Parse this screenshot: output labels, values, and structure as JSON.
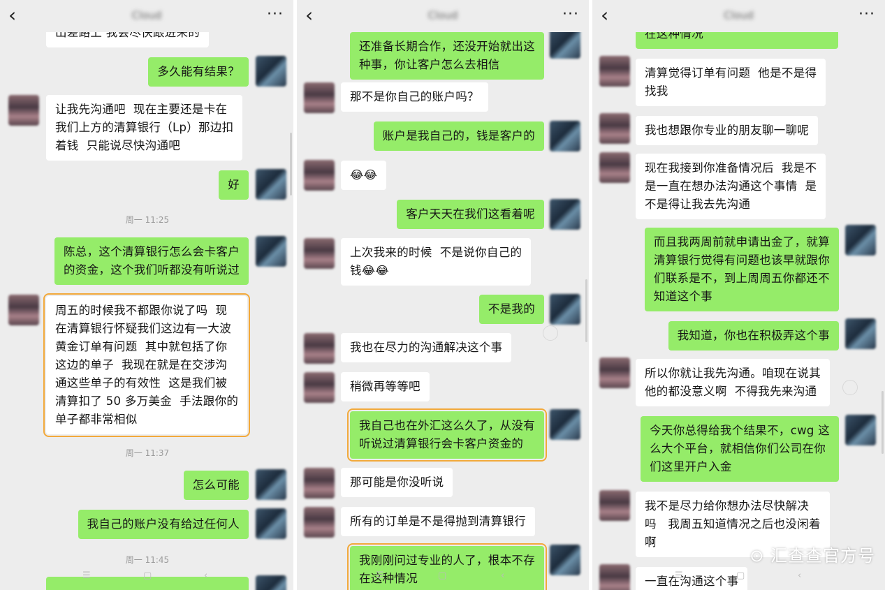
{
  "panels": [
    {
      "title": "Cloud",
      "messages": [
        {
          "side": "in",
          "text": "出差路上 我会尽快跟进来的"
        },
        {
          "side": "out",
          "text": "多久能有结果？"
        },
        {
          "side": "in",
          "text": "让我先沟通吧  现在主要还是卡在\n我们上方的清算银行（Lp）那边扣\n着钱  只能说尽快沟通吧"
        },
        {
          "side": "out",
          "text": "好"
        },
        {
          "time": "周一 11:25"
        },
        {
          "side": "out",
          "text": "陈总，这个清算银行怎么会卡客户\n的资金，这个我们听都没有听说过"
        },
        {
          "side": "in",
          "text": "周五的时候我不都跟你说了吗  现\n在清算银行怀疑我们这边有一大波\n黄金订单有问题  其中就包括了你\n这边的单子  我现在就是在交涉沟\n通这些单子的有效性  这是我们被\n清算扣了 50 多万美金  手法跟你的\n单子都非常相似"
        },
        {
          "time": "周一 11:37"
        },
        {
          "side": "out",
          "text": "怎么可能"
        },
        {
          "side": "out",
          "text": "我自己的账户没有给过任何人"
        },
        {
          "time": "周一 11:45"
        }
      ]
    },
    {
      "title": "Cloud",
      "messages": [
        {
          "side": "out",
          "text": "还准备长期合作，还没开始就出这\n种事，你让客户怎么去相信"
        },
        {
          "side": "in",
          "text": "那不是你自己的账户吗？"
        },
        {
          "side": "out",
          "text": "账户是我自己的，钱是客户的"
        },
        {
          "side": "in",
          "text": "😂😂"
        },
        {
          "side": "out",
          "text": "客户天天在我们这看着呢"
        },
        {
          "side": "in",
          "text": "上次我来的时候  不是说你自己的\n钱😂😂"
        },
        {
          "side": "out",
          "text": "不是我的"
        },
        {
          "side": "in",
          "text": "我也在尽力的沟通解决这个事"
        },
        {
          "side": "in",
          "text": "稍微再等等吧"
        },
        {
          "side": "out",
          "text": "我自己也在外汇这么久了，从没有\n听说过清算银行会卡客户资金的"
        },
        {
          "side": "in",
          "text": "那可能是你没听说"
        },
        {
          "side": "in",
          "text": "所有的订单是不是得抛到清算银行"
        },
        {
          "side": "out",
          "text": "我刚刚问过专业的人了，根本不存\n在这种情况"
        }
      ]
    },
    {
      "title": "Cloud",
      "messages": [
        {
          "side": "out",
          "text": "在这种情况"
        },
        {
          "side": "in",
          "text": "清算觉得订单有问题  他是不是得\n找我"
        },
        {
          "side": "in",
          "text": "我也想跟你专业的朋友聊一聊呢"
        },
        {
          "side": "in",
          "text": "现在我接到你准备情况后  我是不\n是一直在想办法沟通这个事情  是\n不是得让我去先沟通"
        },
        {
          "side": "out",
          "text": "而且我两周前就申请出金了，就算\n清算银行觉得有问题也该早就跟你\n们联系是不，到上周周五你都还不\n知道这个事"
        },
        {
          "side": "out",
          "text": "我知道，你也在积极弄这个事"
        },
        {
          "side": "in",
          "text": "所以你就让我先沟通。咱现在说其\n他的都没意义啊  不得我先来沟通"
        },
        {
          "side": "out",
          "text": "今天你总得给我个结果不，cwg 这\n么大个平台，就相信你们公司在你\n们这里开户入金"
        },
        {
          "side": "in",
          "text": "我不是尽力给你想办法尽快解决\n吗   我周五知道情况之后也没闲着\n啊"
        },
        {
          "side": "in",
          "text": "一直在沟通这个事"
        }
      ]
    }
  ],
  "watermark": "汇查查官方号",
  "icons": {
    "back": "chevron-left-icon",
    "more": "more-dots-icon"
  }
}
